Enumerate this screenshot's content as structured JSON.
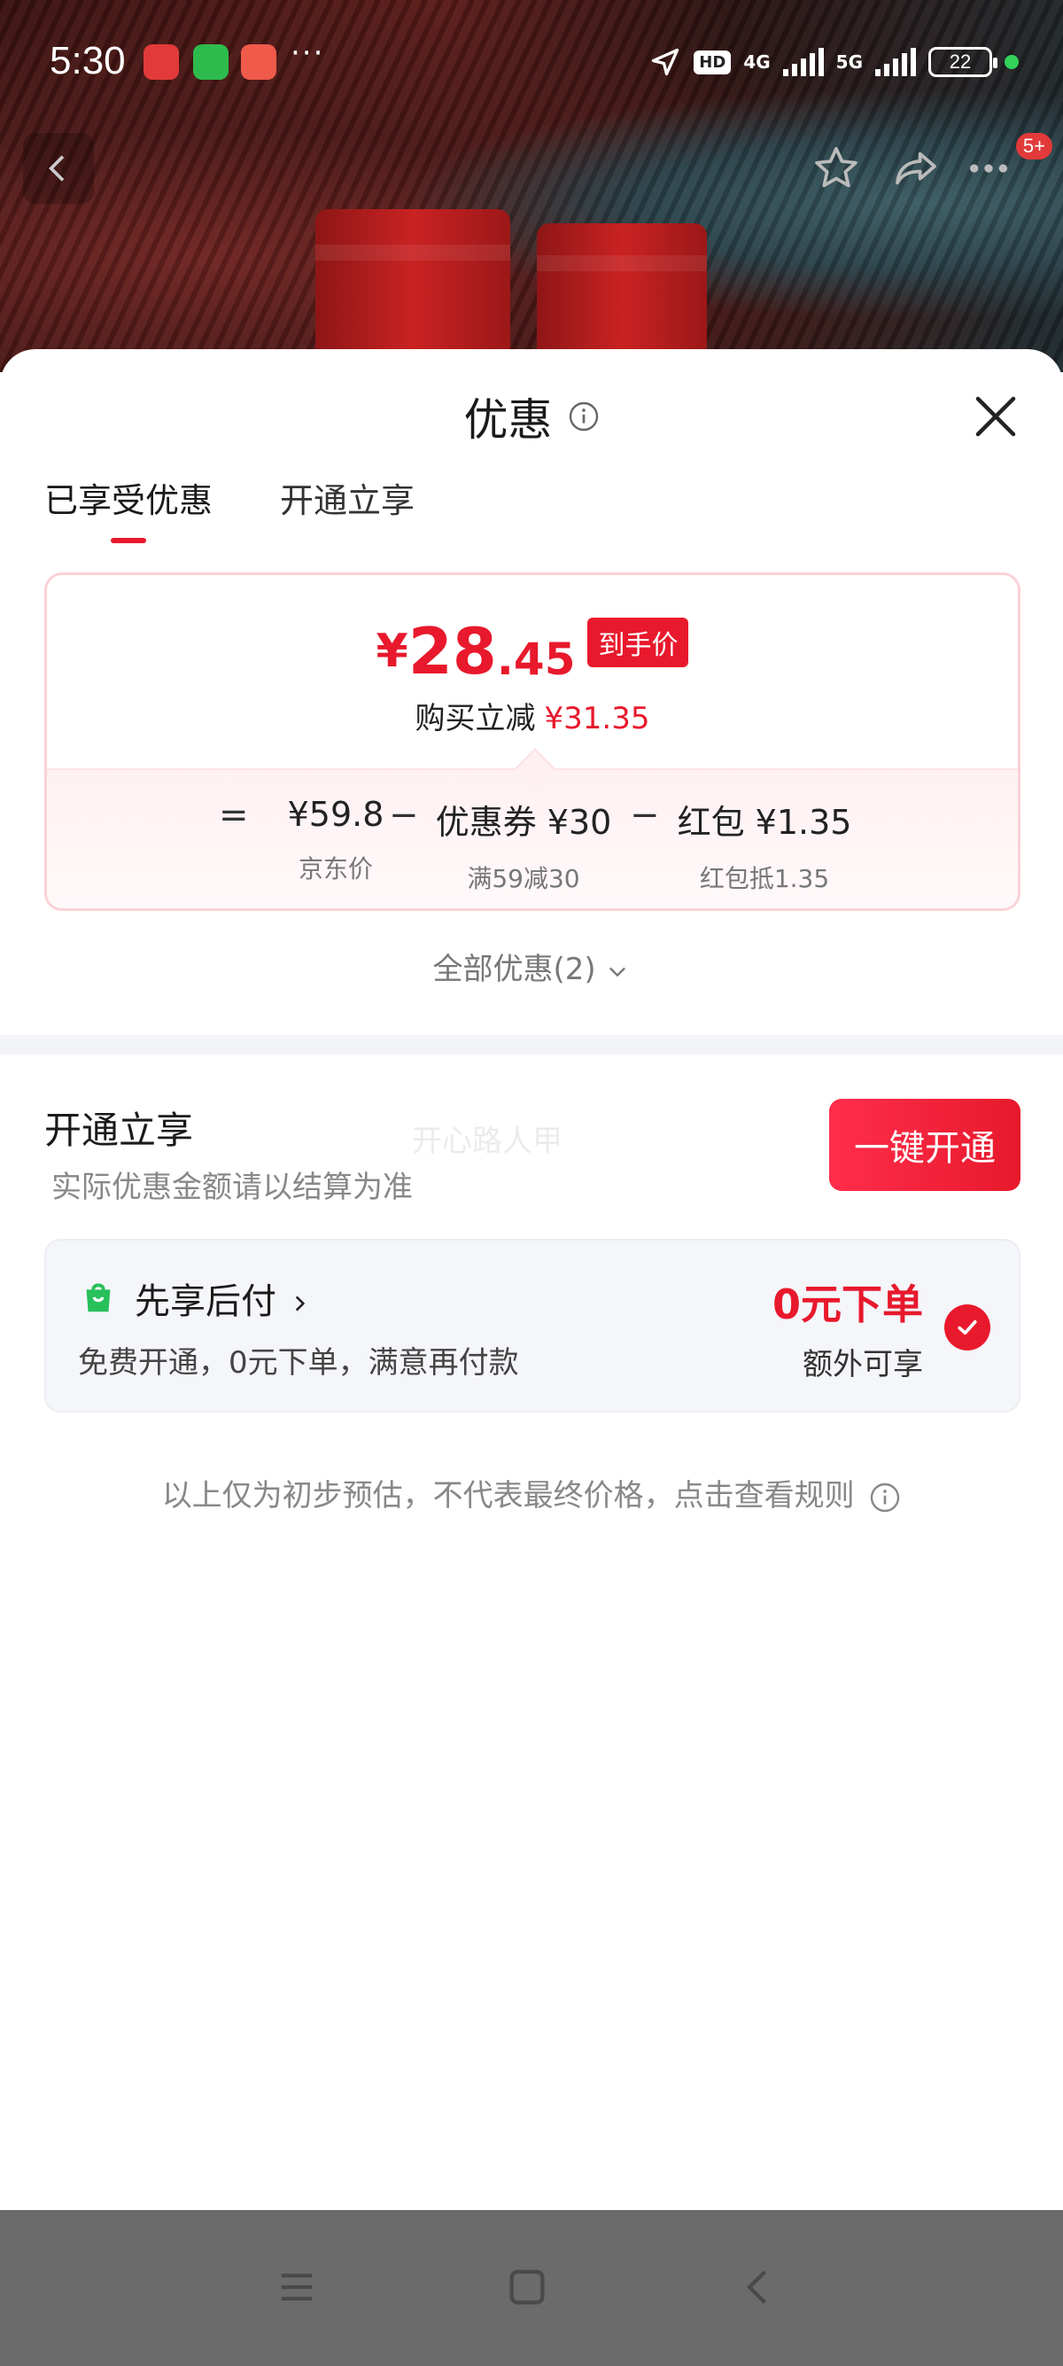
{
  "status_bar": {
    "time": "5:30",
    "more": "···",
    "hd_badge": "HD",
    "net_4g": "4G",
    "net_5g": "5G",
    "battery": "22"
  },
  "top_nav": {
    "badge": "5+"
  },
  "sheet": {
    "title": "优惠",
    "tabs": [
      {
        "label": "已享受优惠",
        "active": true
      },
      {
        "label": "开通立享",
        "active": false
      }
    ],
    "deal": {
      "currency": "¥",
      "price_int": "28",
      "price_dec": ".45",
      "tag": "到手价",
      "reduce_label": "购买立减",
      "reduce_amount": "¥31.35",
      "formula": {
        "eq": "=",
        "minus": "−",
        "items": [
          {
            "value": "¥59.8",
            "sub": "京东价"
          },
          {
            "value": "优惠券 ¥30",
            "sub": "满59减30"
          },
          {
            "value": "红包 ¥1.35",
            "sub": "红包抵1.35"
          }
        ]
      }
    },
    "all_deals": "全部优惠(2)",
    "open_section": {
      "title": "开通立享",
      "subtitle": "实际优惠金额请以结算为准",
      "watermark": "开心路人甲",
      "button": "一键开通"
    },
    "pay_later": {
      "title": "先享后付",
      "description": "免费开通，0元下单，满意再付款",
      "highlight": "0元下单",
      "extra": "额外可享"
    },
    "disclaimer": "以上仅为初步预估，不代表最终价格，点击查看规则"
  },
  "colors": {
    "accent": "#e8192c",
    "card_border": "#fbd2d7",
    "pay_card_bg": "#f5f6fa",
    "green": "#27c05a"
  },
  "icons": [
    "info-icon",
    "close-icon",
    "chevron-down-icon",
    "shopping-bag-icon",
    "check-icon",
    "back-icon",
    "star-icon",
    "share-icon",
    "more-icon",
    "menu-icon",
    "home-icon"
  ]
}
